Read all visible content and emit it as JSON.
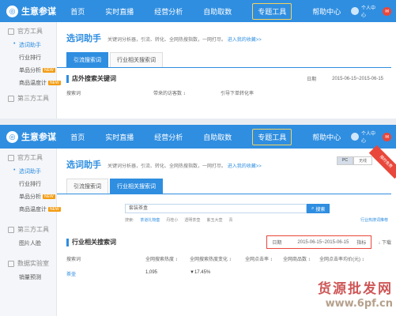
{
  "top": {
    "nav": {
      "logo": "生意参谋",
      "items": [
        "首页",
        "实时直播",
        "经营分析",
        "自助取数",
        "专题工具",
        "帮助中心"
      ],
      "active_index": 4,
      "user": "个人中心"
    },
    "sidebar": {
      "groups": [
        {
          "label": "官方工具",
          "items": [
            {
              "label": "选词助手",
              "active": true,
              "badge": ""
            },
            {
              "label": "行业排行",
              "active": false,
              "badge": ""
            },
            {
              "label": "单品分析",
              "active": false,
              "badge": "NEW"
            },
            {
              "label": "商品温度计",
              "active": false,
              "badge": "NEW"
            }
          ]
        },
        {
          "label": "第三方工具",
          "items": []
        }
      ]
    },
    "main": {
      "title": "选词助手",
      "description": "关键词分析器，引流、转化、全网热搜指数，一网打尽。",
      "favorites_link": "进入我的收藏>>",
      "tabs": [
        "引流搜索词",
        "行业相关搜索词"
      ],
      "active_tab": 0,
      "section_title": "店外搜索关键词",
      "date_label": "日期",
      "date_range": "2015-06-15~2015-06-15",
      "columns": [
        "搜索词",
        "带来的访客数 ↕",
        "引导下单转化率"
      ]
    }
  },
  "bottom": {
    "nav": {
      "logo": "生意参谋",
      "items": [
        "首页",
        "实时直播",
        "经营分析",
        "自助取数",
        "专题工具",
        "帮助中心"
      ],
      "active_index": 4,
      "user": "个人中心"
    },
    "sidebar": {
      "groups": [
        {
          "label": "官方工具",
          "items": [
            {
              "label": "选词助手",
              "active": true,
              "badge": ""
            },
            {
              "label": "行业排行",
              "active": false,
              "badge": ""
            },
            {
              "label": "单品分析",
              "active": false,
              "badge": "NEW"
            },
            {
              "label": "商品温度计",
              "active": false,
              "badge": "NEW"
            }
          ]
        },
        {
          "label": "第三方工具",
          "items": [
            {
              "label": "图片人脸",
              "active": false,
              "badge": ""
            }
          ]
        },
        {
          "label": "数据实验室",
          "items": [
            {
              "label": "销量预测",
              "active": false,
              "badge": ""
            }
          ]
        }
      ]
    },
    "main": {
      "title": "选词助手",
      "description": "关键词分析器，引流、转化、全网热搜指数，一网打尽。",
      "favorites_link": "进入我的收藏>>",
      "tabs": [
        "引流搜索词",
        "行业相关搜索词"
      ],
      "active_tab": 1,
      "device_toggle": [
        "PC",
        "无线"
      ],
      "active_device": 0,
      "ribbon": "限时免费",
      "search_value": "套装茶盒",
      "search_button": "搜索",
      "hot_label": "搜索:",
      "hot_words": [
        "茶道礼物套",
        "丹桂小",
        "透明茶壶",
        "紫玉大壶",
        "青"
      ],
      "hot_right": "行业热搜词推荐",
      "section_title": "行业相关搜索词",
      "date_label": "日期",
      "date_range": "2015-06-15~2015-06-15",
      "metric_label": "指标",
      "download": "下载",
      "columns": [
        "搜索词",
        "全网搜索热度 ↕",
        "全网搜索热度变化 ↕",
        "全网点击率 ↕",
        "全网商品数 ↕",
        "全网点击率均价(元) ↕"
      ],
      "rows": [
        {
          "keyword": "茶壶",
          "heat": "1,095",
          "heat_change": "▼17.45%"
        }
      ]
    }
  },
  "watermark": {
    "text": "货源批发网",
    "url": "www.6pf.cn"
  }
}
